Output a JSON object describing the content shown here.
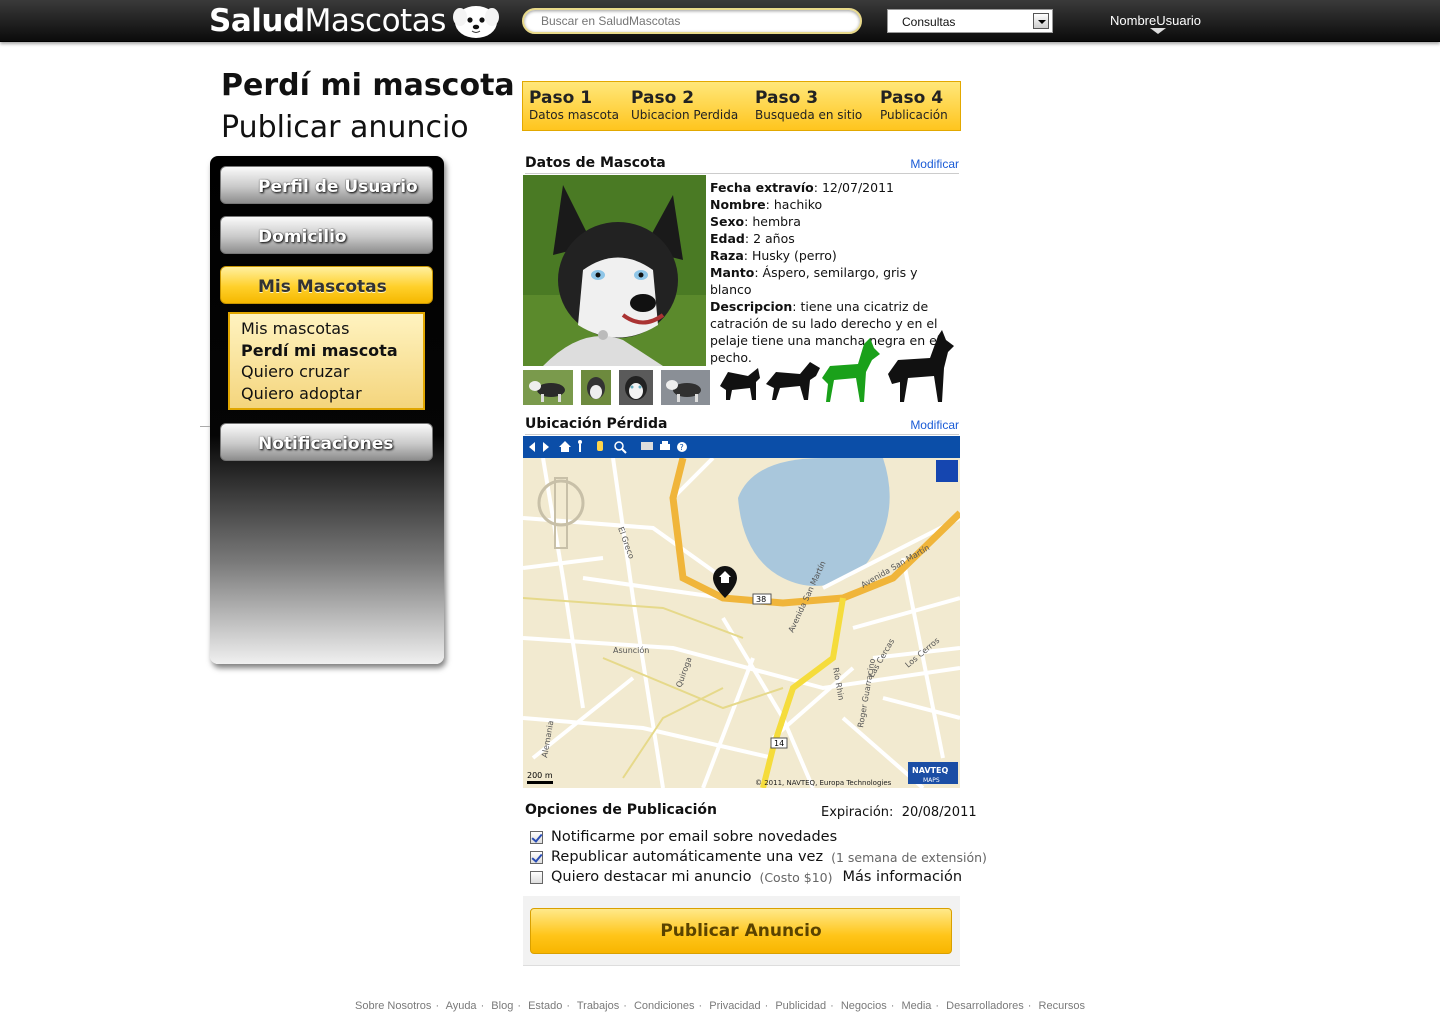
{
  "header": {
    "logo_bold": "Salud",
    "logo_light": "Mascotas",
    "search_placeholder": "Buscar en SaludMascotas",
    "select_value": "Consultas",
    "username": "NombreUsuario"
  },
  "page": {
    "title": "Perdí mi mascota",
    "subtitle": "Publicar anuncio"
  },
  "sidebar": {
    "items": [
      "Perfil de Usuario",
      "Domicilio",
      "Mis Mascotas",
      "Notificaciones"
    ],
    "submenu": [
      "Mis mascotas",
      "Perdí mi mascota",
      "Quiero cruzar",
      "Quiero adoptar"
    ]
  },
  "steps": [
    {
      "step": "Paso 1",
      "desc": "Datos mascota"
    },
    {
      "step": "Paso 2",
      "desc": "Ubicacion Perdida"
    },
    {
      "step": "Paso 3",
      "desc": "Busqueda en sitio"
    },
    {
      "step": "Paso 4",
      "desc": "Publicación"
    }
  ],
  "pet": {
    "section_title": "Datos de Mascota",
    "modify": "Modificar",
    "fields": [
      {
        "label": "Fecha extravío",
        "value": "12/07/2011"
      },
      {
        "label": "Nombre",
        "value": "hachiko"
      },
      {
        "label": "Sexo",
        "value": " hembra"
      },
      {
        "label": "Edad",
        "value": "2 años"
      },
      {
        "label": "Raza",
        "value": "Husky (perro)"
      },
      {
        "label": "Manto",
        "value": "Áspero, semilargo, gris y blanco"
      },
      {
        "label": "Descripcion",
        "value": "tiene una cicatriz de catración de su lado derecho y en el pelaje tiene una mancha negra en el pecho."
      }
    ],
    "selected_size_color": "#1aa11a"
  },
  "location": {
    "section_title": "Ubicación Pérdida",
    "modify": "Modificar",
    "map_labels": {
      "road_38": "38",
      "road_14": "14",
      "scale": "200 m",
      "copyright": "© 2011, NAVTEQ, Europa Technologies",
      "navteq": "NAVTEQ",
      "maps": "MAPS",
      "streets": [
        "Avenida San Martín",
        "Avenida San Martín",
        "Asunción",
        "El Greco",
        "Las Cercas",
        "Los Cerros",
        "Río Rhin",
        "Quiroga",
        "Roger Guarracino",
        "Alemania"
      ]
    }
  },
  "options": {
    "title": "Opciones de Publicación",
    "expiration_label": "Expiración:",
    "expiration_value": "20/08/2011",
    "items": [
      {
        "label": "Notificarme por email sobre novedades",
        "note": "",
        "more": "",
        "checked": true
      },
      {
        "label": "Republicar automáticamente una vez",
        "note": "(1 semana de extensión)",
        "more": "",
        "checked": true
      },
      {
        "label": "Quiero destacar mi anuncio",
        "note": "(Costo $10)",
        "more": "Más información",
        "checked": false
      }
    ],
    "publish_button": "Publicar Anuncio"
  },
  "footer": {
    "links": [
      "Sobre Nosotros",
      "Ayuda",
      "Blog",
      "Estado",
      "Trabajos",
      "Condiciones",
      "Privacidad",
      "Publicidad",
      "Negocios",
      "Media",
      "Desarrolladores",
      "Recursos"
    ],
    "separator": "·"
  },
  "colors": {
    "accent_yellow": "#ffc51e",
    "link_blue": "#1a5bd6",
    "header_dark": "#1a1a1a"
  }
}
